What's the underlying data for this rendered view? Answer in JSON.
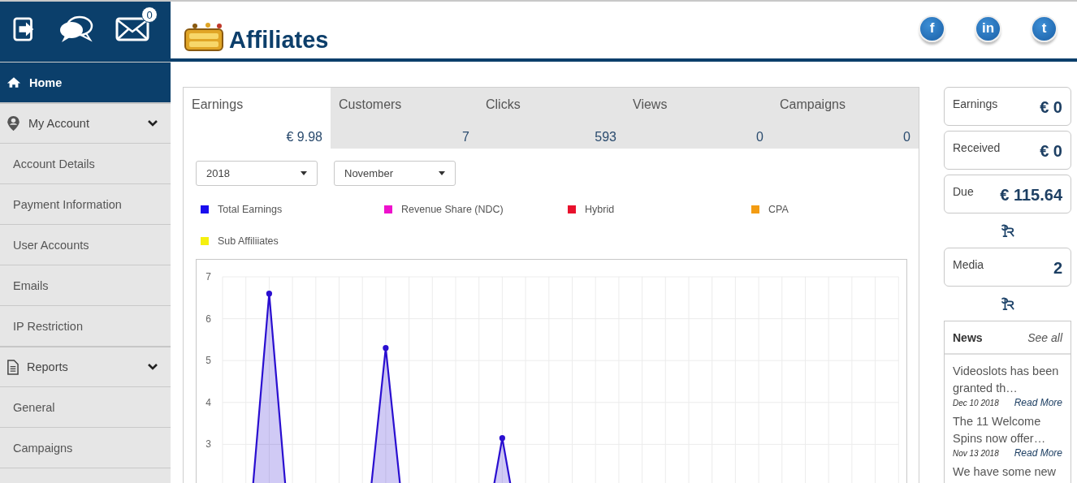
{
  "header": {
    "notification_count": "0",
    "title": "Affiliates",
    "social": [
      {
        "glyph": "f"
      },
      {
        "glyph": "in"
      },
      {
        "glyph": "t"
      }
    ]
  },
  "sidebar": {
    "items": [
      {
        "label": "Home",
        "selected": true
      },
      {
        "label": "My Account",
        "selected": false,
        "expanded": true,
        "children": [
          {
            "label": "Account Details",
            "selected": false
          },
          {
            "label": "Payment Information",
            "selected": false
          },
          {
            "label": "User Accounts",
            "selected": false
          },
          {
            "label": "Emails",
            "selected": false
          },
          {
            "label": "IP Restriction",
            "selected": false
          }
        ]
      },
      {
        "label": "Reports",
        "selected": false,
        "expanded": true,
        "children": [
          {
            "label": "General",
            "selected": false
          },
          {
            "label": "Campaigns",
            "selected": false
          }
        ]
      }
    ]
  },
  "tabs": [
    {
      "label": "Earnings",
      "value": "€ 9.98",
      "selected": true
    },
    {
      "label": "Customers",
      "value": "7",
      "selected": false
    },
    {
      "label": "Clicks",
      "value": "593",
      "selected": false
    },
    {
      "label": "Views",
      "value": "0",
      "selected": false
    },
    {
      "label": "Campaigns",
      "value": "0",
      "selected": false
    }
  ],
  "filters": {
    "year": "2018",
    "month": "November"
  },
  "legend": [
    {
      "label": "Total Earnings",
      "color": "#1a0dee"
    },
    {
      "label": "Revenue Share (NDC)",
      "color": "#ee11cc"
    },
    {
      "label": "Hybrid",
      "color": "#e8112d"
    },
    {
      "label": "CPA",
      "color": "#f39c12"
    },
    {
      "label": "Sub Affiliiates",
      "color": "#f5f00f"
    }
  ],
  "chart_data": {
    "type": "area",
    "ylim": [
      0,
      7
    ],
    "yticks": [
      3,
      4,
      5,
      6,
      7
    ],
    "grid": true,
    "series": [
      {
        "color": "#2a0fd0",
        "values": [
          0,
          0,
          6.6,
          0,
          0,
          0,
          0,
          5.3,
          0,
          0,
          0,
          0,
          3.15,
          0,
          0,
          0,
          0,
          0,
          0,
          0,
          0,
          0,
          0,
          0,
          0,
          0,
          0,
          0,
          0,
          0
        ]
      }
    ]
  },
  "summary": [
    {
      "kind": "stat",
      "label": "Earnings",
      "value": "€ 0"
    },
    {
      "kind": "stat",
      "label": "Received",
      "value": "€ 0"
    },
    {
      "kind": "stat",
      "label": "Due",
      "value": "€ 115.64"
    },
    {
      "kind": "mark"
    },
    {
      "kind": "stat",
      "label": "Media",
      "value": "2"
    },
    {
      "kind": "mark"
    }
  ],
  "news": {
    "title": "News",
    "see_all": "See all",
    "items": [
      {
        "title": "Videoslots has been granted th…",
        "date": "Dec 10 2018",
        "link": "Read More"
      },
      {
        "title": "The 11 Welcome Spins now offer…",
        "date": "Nov 13 2018",
        "link": "Read More"
      },
      {
        "title": "We have some new"
      }
    ]
  }
}
